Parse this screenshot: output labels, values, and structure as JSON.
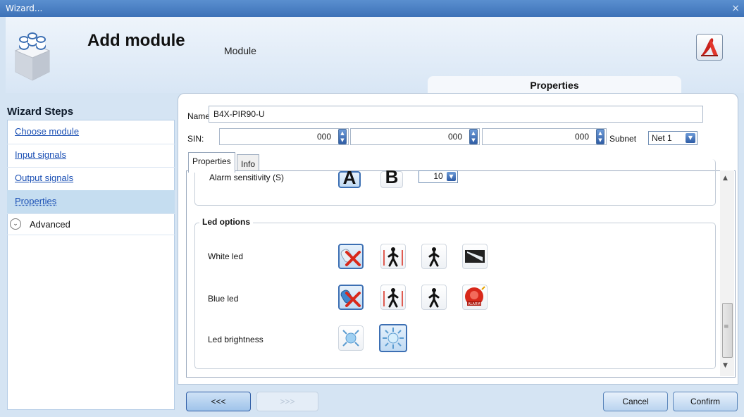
{
  "window": {
    "title": "Wizard...",
    "close_glyph": "×"
  },
  "header": {
    "title": "Add module",
    "subtitle": "Module",
    "tab_label": "Properties",
    "logo_icon": "module-blocks-icon",
    "export_icon": "pdf-export-icon"
  },
  "sidebar": {
    "title": "Wizard Steps",
    "items": [
      {
        "label": "Choose module"
      },
      {
        "label": "Input signals"
      },
      {
        "label": "Output signals"
      },
      {
        "label": "Properties",
        "active": true
      }
    ],
    "advanced_label": "Advanced",
    "advanced_glyph": "⌄"
  },
  "form": {
    "name_label": "Name",
    "name_value": "B4X-PIR90-U",
    "sin_label": "SIN:",
    "sin_values": [
      "000",
      "000",
      "000"
    ],
    "subnet_label": "Subnet",
    "subnet_value": "Net 1"
  },
  "inner_tabs": [
    "Properties",
    "Info"
  ],
  "alarm": {
    "label": "Alarm sensitivity (S)",
    "btn_a": "A",
    "btn_b": "B",
    "value": "10"
  },
  "led_options": {
    "legend": "Led options",
    "rows": [
      {
        "label": "White led",
        "icons": [
          "led-off-icon",
          "person-red-icon",
          "person-black-icon",
          "light-beam-icon"
        ]
      },
      {
        "label": "Blue led",
        "icons": [
          "led-off-icon",
          "person-red-icon",
          "person-black-icon",
          "alarm-bell-icon"
        ]
      },
      {
        "label": "Led brightness",
        "icons": [
          "brightness-low-icon",
          "brightness-high-icon"
        ]
      }
    ],
    "alarm_icon_text": "ALARM"
  },
  "scroll": {
    "position": 0.78
  },
  "footer": {
    "back": "<<<",
    "next": ">>>",
    "cancel": "Cancel",
    "confirm": "Confirm"
  },
  "colors": {
    "accent": "#3c6fb3",
    "link": "#1a4fb4",
    "led_blue": "#3f87cf",
    "led_red": "#d8281a"
  }
}
